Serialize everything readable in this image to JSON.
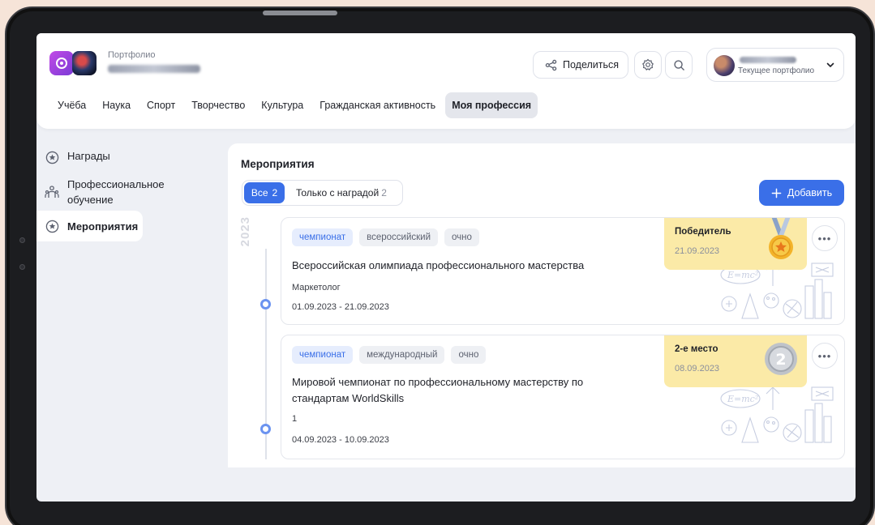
{
  "app": {
    "title": "Портфолио",
    "user_name_blurred": "Саня Гвоздев"
  },
  "header": {
    "share_label": "Поделиться",
    "user_subtitle": "Текущее портфолио",
    "user_name_blurred": "Саня Гвоздев"
  },
  "nav": {
    "tabs": [
      {
        "label": "Учёба"
      },
      {
        "label": "Наука"
      },
      {
        "label": "Спорт"
      },
      {
        "label": "Творчество"
      },
      {
        "label": "Культура"
      },
      {
        "label": "Гражданская активность"
      },
      {
        "label": "Моя профессия",
        "active": true
      }
    ]
  },
  "sidebar": {
    "items": [
      {
        "label": "Награды",
        "icon": "star-badge-icon"
      },
      {
        "label": "Профессиональное обучение",
        "label_line1": "Профессиональное",
        "label_line2": "обучение",
        "icon": "people-icon"
      },
      {
        "label": "Мероприятия",
        "icon": "star-badge-icon",
        "active": true
      }
    ]
  },
  "main": {
    "title": "Мероприятия",
    "filter": {
      "all_label": "Все",
      "all_count": "2",
      "award_label": "Только с наградой",
      "award_count": "2"
    },
    "add_label": "Добавить",
    "year": "2023",
    "cards": [
      {
        "tags": [
          "чемпионат",
          "всероссийский",
          "очно"
        ],
        "title": "Всероссийская олимпиада профессионального мастерства",
        "subtitle": "Маркетолог",
        "dates": "01.09.2023 - 21.09.2023",
        "award": {
          "title": "Победитель",
          "date": "21.09.2023",
          "medal": "gold-medal-icon"
        }
      },
      {
        "tags": [
          "чемпионат",
          "международный",
          "очно"
        ],
        "title_line1": "Мировой чемпионат по профессиональному мастерству по",
        "title_line2": "стандартам WorldSkills",
        "subtitle": "1",
        "dates": "04.09.2023 - 10.09.2023",
        "award": {
          "title": "2-е место",
          "date": "08.09.2023",
          "medal": "silver-medal-icon",
          "medal_text": "2"
        }
      }
    ]
  },
  "colors": {
    "accent": "#3a6fe8",
    "award_bg": "#fbeaa7",
    "page_bg": "#f6e4d8"
  }
}
